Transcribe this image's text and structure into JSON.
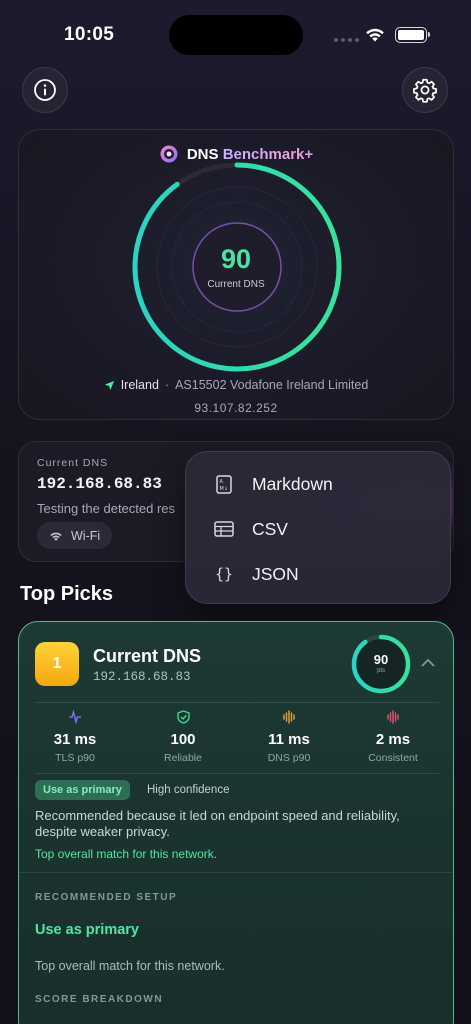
{
  "status_bar": {
    "time": "10:05"
  },
  "hero": {
    "brand_name": "DNS",
    "brand_bench": "Benchmark",
    "brand_plus": "+",
    "score": "90",
    "score_label": "Current DNS",
    "score_fraction": 0.9,
    "country": "Ireland",
    "separator": "·",
    "asn": "AS15502 Vodafone Ireland Limited",
    "public_ip": "93.107.82.252"
  },
  "current_dns": {
    "label": "Current DNS",
    "ip": "192.168.68.83",
    "subtitle": "Testing the detected res",
    "connection": "Wi-Fi"
  },
  "export_menu": {
    "items": [
      {
        "label": "Markdown",
        "icon": "markdown-icon"
      },
      {
        "label": "CSV",
        "icon": "table-icon"
      },
      {
        "label": "JSON",
        "icon": "braces-icon"
      }
    ]
  },
  "top_picks": {
    "title": "Top Picks",
    "card": {
      "rank": "1",
      "name": "Current DNS",
      "ip": "192.168.68.83",
      "score": "90",
      "score_unit": "pts",
      "score_fraction": 0.9,
      "stats": [
        {
          "value": "31 ms",
          "label": "TLS p90",
          "icon": "pulse-icon",
          "color": "#7d6cf0"
        },
        {
          "value": "100",
          "label": "Reliable",
          "icon": "shield-check-icon",
          "color": "#3fd78f"
        },
        {
          "value": "11 ms",
          "label": "DNS p90",
          "icon": "waveform-icon",
          "color": "#e09a3a"
        },
        {
          "value": "2 ms",
          "label": "Consistent",
          "icon": "waveform-icon",
          "color": "#e0506a"
        }
      ],
      "badge": "Use as primary",
      "confidence": "High confidence",
      "recommendation": "Recommended because it led on endpoint speed and reliability, despite weaker privacy.",
      "note": "Top overall match for this network.",
      "recommended_setup_label": "RECOMMENDED SETUP",
      "setup_title": "Use as primary",
      "setup_desc": "Top overall match for this network.",
      "score_breakdown_label": "SCORE BREAKDOWN"
    }
  },
  "colors": {
    "accent_green": "#4ee7a4",
    "gauge_teal": "#2fd8c0",
    "rank_gold": "#f5b815"
  }
}
